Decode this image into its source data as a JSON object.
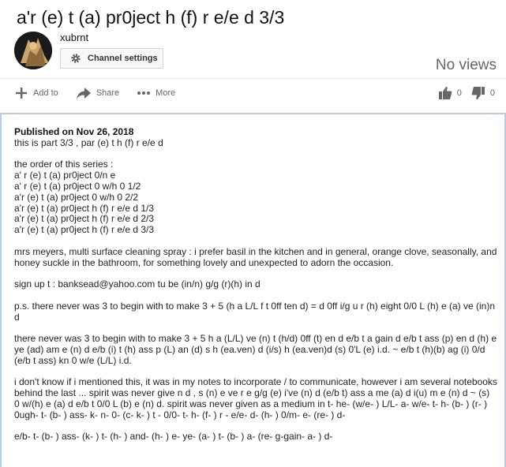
{
  "video": {
    "title": "a'r (e) t (a) pr0ject h (f) r e/e d 3/3",
    "views": "No views"
  },
  "channel": {
    "name": "xubrnt",
    "settings_label": "Channel settings"
  },
  "actions": {
    "add_to": "Add to",
    "share": "Share",
    "more": "More",
    "likes": "0",
    "dislikes": "0"
  },
  "description": {
    "published": "Published on Nov 26, 2018",
    "intro": "this is part 3/3 , par (e) t h (f) r e/e d",
    "series_heading": "the order of this series :",
    "series": [
      "a' r (e) t (a) pr0ject 0/n e",
      "a' r (e) t (a) pr0ject 0 w/h 0 1/2",
      "a'r (e) t (a) pr0ject 0 w/h 0 2/2",
      "a'r (e) t (a) pr0ject h (f) r e/e d 1/3",
      "a'r (e) t (a) pr0ject h (f) r e/e d 2/3",
      "a'r (e) t (a) pr0ject h (f) r e/e d 3/3"
    ],
    "spray": "mrs meyers, multi surface cleaning spray : i prefer basil in the kitchen and in general, orange clove, seasonally, and honey suckle in the bathroom, for something lovely and unexpected to adorn the occasion.",
    "signup": "sign up t : banksead@yahoo.com tu be (in/n) g/g (r)(h) in d",
    "ps": "p.s. there never was 3 to begin with to make 3 + 5 (h a L/L f t 0ff ten d) = d 0ff i/g u r (h) eight 0/0 L (h) e (a) ve (in)n d",
    "never": "there never was 3 to begin with to make 3 + 5 h a (L/L) ve (n) t (h/d) 0ff (t) en d e/b t a gain d e/b t ass (p) en d (h) e ye (ad) am e (n) d e/b (i) t (h) ass p (L) an (d) s h (ea.ven) d (i/s) h (ea.ven)d (s) 0'L (e) i.d. ~ e/b t (h)(b) ag (i) 0/d (e/b t ass) kn 0 w/e (L/L) i.d.",
    "dontknow": "i don't know if i mentioned this, it was in my notes to incorporate / to communicate, however i am several notebooks behind the last ... spirit was never give n d , s (n) e ve r e g/g (e) i've (n) d (e/b t) ass a me (a) d i(u) m e (n) d ~ (s) 0 w/(h) e (a) d e/b t 0/0 L (b) e (n) d. spirit was never given as a medium in t- he- (w/e- ) L/L- a- w/e- t- h- (b- ) (r- ) 0ugh- t- (b- ) ass- k- n- 0- (c- k- ) t - 0/0- t- h- (f- ) r - e/e- d- (h- ) 0/m- e- (re- ) d-",
    "last": "e/b- t- (b- ) ass- (k- ) t- (h- ) and- (h- ) e- ye- (a- ) t- (b- ) a- (re- g-gain- a- ) d-"
  }
}
